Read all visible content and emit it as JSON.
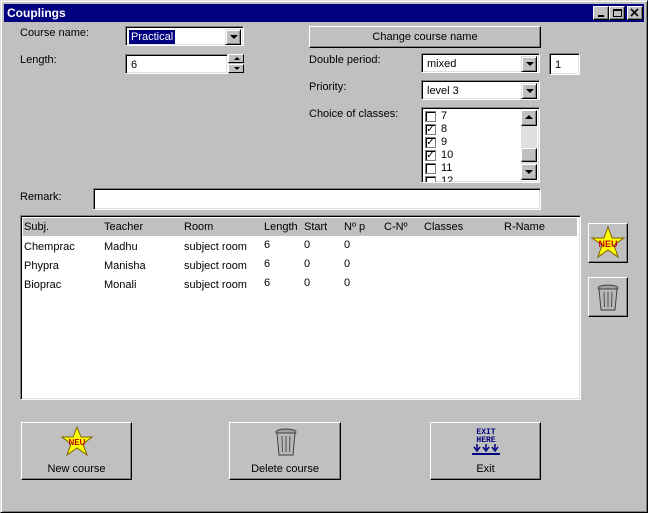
{
  "window": {
    "title": "Couplings"
  },
  "form": {
    "course_name_label": "Course name:",
    "course_name_value": "Practical",
    "length_label": "Length:",
    "length_value": "6",
    "change_course_name_label": "Change course name",
    "double_period_label": "Double period:",
    "double_period_value": "mixed",
    "double_period_count": "1",
    "priority_label": "Priority:",
    "priority_value": "level 3",
    "choice_of_classes_label": "Choice of classes:",
    "classes": [
      {
        "name": "7",
        "checked": false
      },
      {
        "name": "8",
        "checked": true
      },
      {
        "name": "9",
        "checked": true
      },
      {
        "name": "10",
        "checked": true
      },
      {
        "name": "11",
        "checked": false
      },
      {
        "name": "12",
        "checked": false
      }
    ],
    "remark_label": "Remark:",
    "remark_value": ""
  },
  "grid": {
    "columns": [
      "Subj.",
      "Teacher",
      "Room",
      "Length",
      "Start",
      "Nº p",
      "C-Nº",
      "Classes",
      "R-Name"
    ],
    "rows": [
      {
        "subj": "Chemprac",
        "teacher": "Madhu",
        "room": "subject room",
        "length": "6",
        "start": "0",
        "np": "0"
      },
      {
        "subj": "Phypra",
        "teacher": "Manisha",
        "room": "subject room",
        "length": "6",
        "start": "0",
        "np": "0"
      },
      {
        "subj": "Bioprac",
        "teacher": "Monali",
        "room": "subject room",
        "length": "6",
        "start": "0",
        "np": "0"
      }
    ]
  },
  "buttons": {
    "new_course": "New course",
    "delete_course": "Delete course",
    "exit": "Exit",
    "new_icon_text": "NEU",
    "exit_icon_line1": "EXIT",
    "exit_icon_line2": "HERE"
  },
  "icons": {
    "new": "star-new-icon",
    "trash": "trash-can-icon",
    "exit": "exit-here-icon"
  },
  "colors": {
    "titlebar": "#000080",
    "face": "#c0c0c0",
    "star": "#ffff00",
    "exit_icon": "#000080"
  }
}
